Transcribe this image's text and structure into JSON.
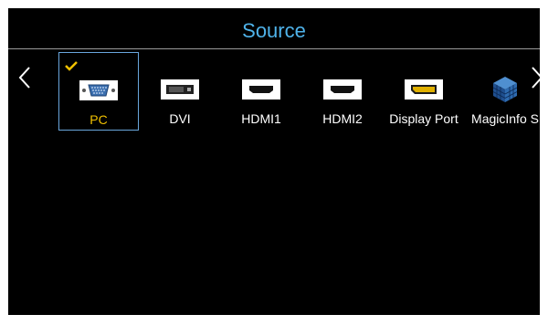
{
  "title": "Source",
  "colors": {
    "accent_title": "#4fb3ea",
    "selected_label": "#f0c000",
    "selected_border": "#6aa6dc",
    "background": "#000000"
  },
  "nav": {
    "prev_icon": "chevron-left-icon",
    "next_icon": "chevron-right-icon"
  },
  "sources": [
    {
      "label": "PC",
      "icon": "vga-port-icon",
      "selected": true
    },
    {
      "label": "DVI",
      "icon": "dvi-port-icon",
      "selected": false
    },
    {
      "label": "HDMI1",
      "icon": "hdmi-port-icon",
      "selected": false
    },
    {
      "label": "HDMI2",
      "icon": "hdmi-port-icon",
      "selected": false
    },
    {
      "label": "Display Port",
      "icon": "displayport-icon",
      "selected": false
    },
    {
      "label": "MagicInfo S",
      "icon": "magicinfo-cube-icon",
      "selected": false
    }
  ]
}
